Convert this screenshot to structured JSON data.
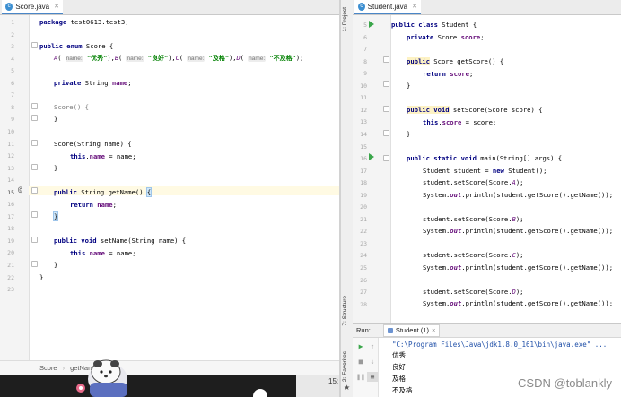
{
  "left_editor": {
    "tab_label": "Score.java",
    "tab_icon": "class-file-icon",
    "line_numbers": [
      "1",
      "2",
      "3",
      "4",
      "5",
      "6",
      "7",
      "8",
      "9",
      "10",
      "11",
      "12",
      "13",
      "14",
      "15",
      "16",
      "17",
      "18",
      "19",
      "20",
      "21",
      "22",
      "23"
    ],
    "current_line": "15",
    "override_marker": "@",
    "lines": {
      "l1_kw": "package",
      "l1_rest": " test0613.test3;",
      "l3_kw": "public enum",
      "l3_rest": " Score {",
      "l4": {
        "a": "A",
        "a_hint": "name:",
        "a_val": "\"优秀\"",
        "b": "B",
        "b_hint": "name:",
        "b_val": "\"良好\"",
        "c": "C",
        "c_hint": "name:",
        "c_val": "\"及格\"",
        "d": "D",
        "d_hint": "name:",
        "d_val": "\"不及格\""
      },
      "l6_kw": "private",
      "l6_type": " String ",
      "l6_field": "name",
      "l8": "Score() {",
      "l9": "}",
      "l11": "Score(String name) {",
      "l12_kw": "this",
      "l12_field": "name",
      "l12_rest": " = name;",
      "l13": "}",
      "l15_kw": "public",
      "l15_rest": " String getName() ",
      "l15_brace": "{",
      "l16_kw": "return",
      "l16_field": "name",
      "l17": "}",
      "l19_kw": "public void",
      "l19_rest": " setName(String name) {",
      "l20_kw": "this",
      "l20_field": "name",
      "l20_rest": " = name;",
      "l21": "}",
      "l22": "}"
    },
    "breadcrumb": [
      "Score",
      "getName"
    ],
    "status_fragment": "15:"
  },
  "right_editor": {
    "tab_label": "Student.java",
    "tab_icon": "class-file-icon",
    "line_numbers": [
      "5",
      "6",
      "7",
      "8",
      "9",
      "10",
      "11",
      "12",
      "13",
      "14",
      "15",
      "16",
      "17",
      "18",
      "19",
      "20",
      "21",
      "22",
      "23",
      "24",
      "25",
      "26",
      "27",
      "28"
    ],
    "lines": {
      "l5_kw": "public class",
      "l5_rest": " Student {",
      "l6_kw": "private",
      "l6_type": " Score ",
      "l6_field": "score",
      "l8_kw": "public",
      "l8_rest": " Score getScore() {",
      "l9_kw": "return",
      "l9_field": "score",
      "l10": "}",
      "l12_kw": "public void",
      "l12_rest": " setScore(Score score) {",
      "l13_kw": "this",
      "l13_field": "score",
      "l13_rest": " = score;",
      "l14": "}",
      "l16_kw": "public static void",
      "l16_rest": " main(String[] args) {",
      "l17_a": "Student student = ",
      "l17_kw": "new",
      "l17_b": " Student();",
      "set_prefix": "student.setScore(Score.",
      "set_suffix": ");",
      "print_prefix": "System.",
      "print_out": "out",
      "print_suffix": ".println(student.getScore().getName());",
      "enum_a": "A",
      "enum_b": "B",
      "enum_c": "C",
      "enum_d": "D"
    },
    "side_labels": [
      "1: Project",
      "7: Structure",
      "2: Favorites"
    ]
  },
  "run_panel": {
    "run_label": "Run:",
    "tab_label": "Student (1)",
    "tab_close": "×",
    "command": "\"C:\\Program Files\\Java\\jdk1.8.0_161\\bin\\java.exe\" ...",
    "output": [
      "优秀",
      "良好",
      "及格",
      "不及格"
    ]
  },
  "watermark": "CSDN @toblankly",
  "colors": {
    "keyword": "#000080",
    "field": "#660e7a",
    "string": "#008000",
    "current_line_bg": "#fffae3",
    "run_green": "#3aa64a"
  }
}
